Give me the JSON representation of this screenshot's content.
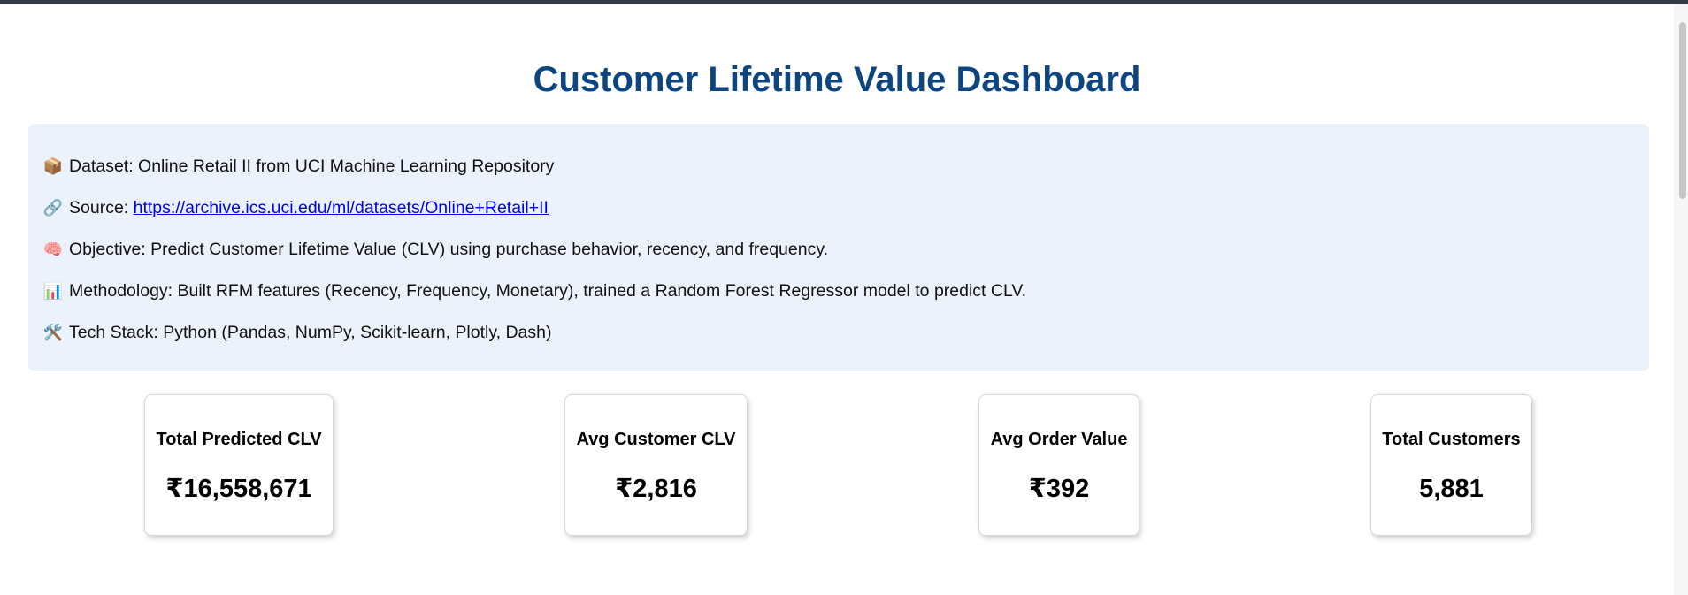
{
  "page": {
    "title": "Customer Lifetime Value Dashboard"
  },
  "info": {
    "dataset": {
      "icon": "📦",
      "icon_name": "package-icon",
      "label": "Dataset:",
      "text": "Online Retail II from UCI Machine Learning Repository"
    },
    "source": {
      "icon": "🔗",
      "icon_name": "link-icon",
      "label": "Source:",
      "link": "https://archive.ics.uci.edu/ml/datasets/Online+Retail+II"
    },
    "objective": {
      "icon": "🧠",
      "icon_name": "brain-icon",
      "label": "Objective:",
      "text": "Predict Customer Lifetime Value (CLV) using purchase behavior, recency, and frequency."
    },
    "methodology": {
      "icon": "📊",
      "icon_name": "bar-chart-icon",
      "label": "Methodology:",
      "text": "Built RFM features (Recency, Frequency, Monetary), trained a Random Forest Regressor model to predict CLV."
    },
    "tech_stack": {
      "icon": "🛠️",
      "icon_name": "tools-icon",
      "label": "Tech Stack:",
      "text": "Python (Pandas, NumPy, Scikit-learn, Plotly, Dash)"
    }
  },
  "kpis": [
    {
      "label": "Total Predicted CLV",
      "value": "₹16,558,671"
    },
    {
      "label": "Avg Customer CLV",
      "value": "₹2,816"
    },
    {
      "label": "Avg Order Value",
      "value": "₹392"
    },
    {
      "label": "Total Customers",
      "value": "5,881"
    }
  ],
  "colors": {
    "title": "#0c4580",
    "panel_bg": "#ebf2fb",
    "link": "#0000ee"
  }
}
